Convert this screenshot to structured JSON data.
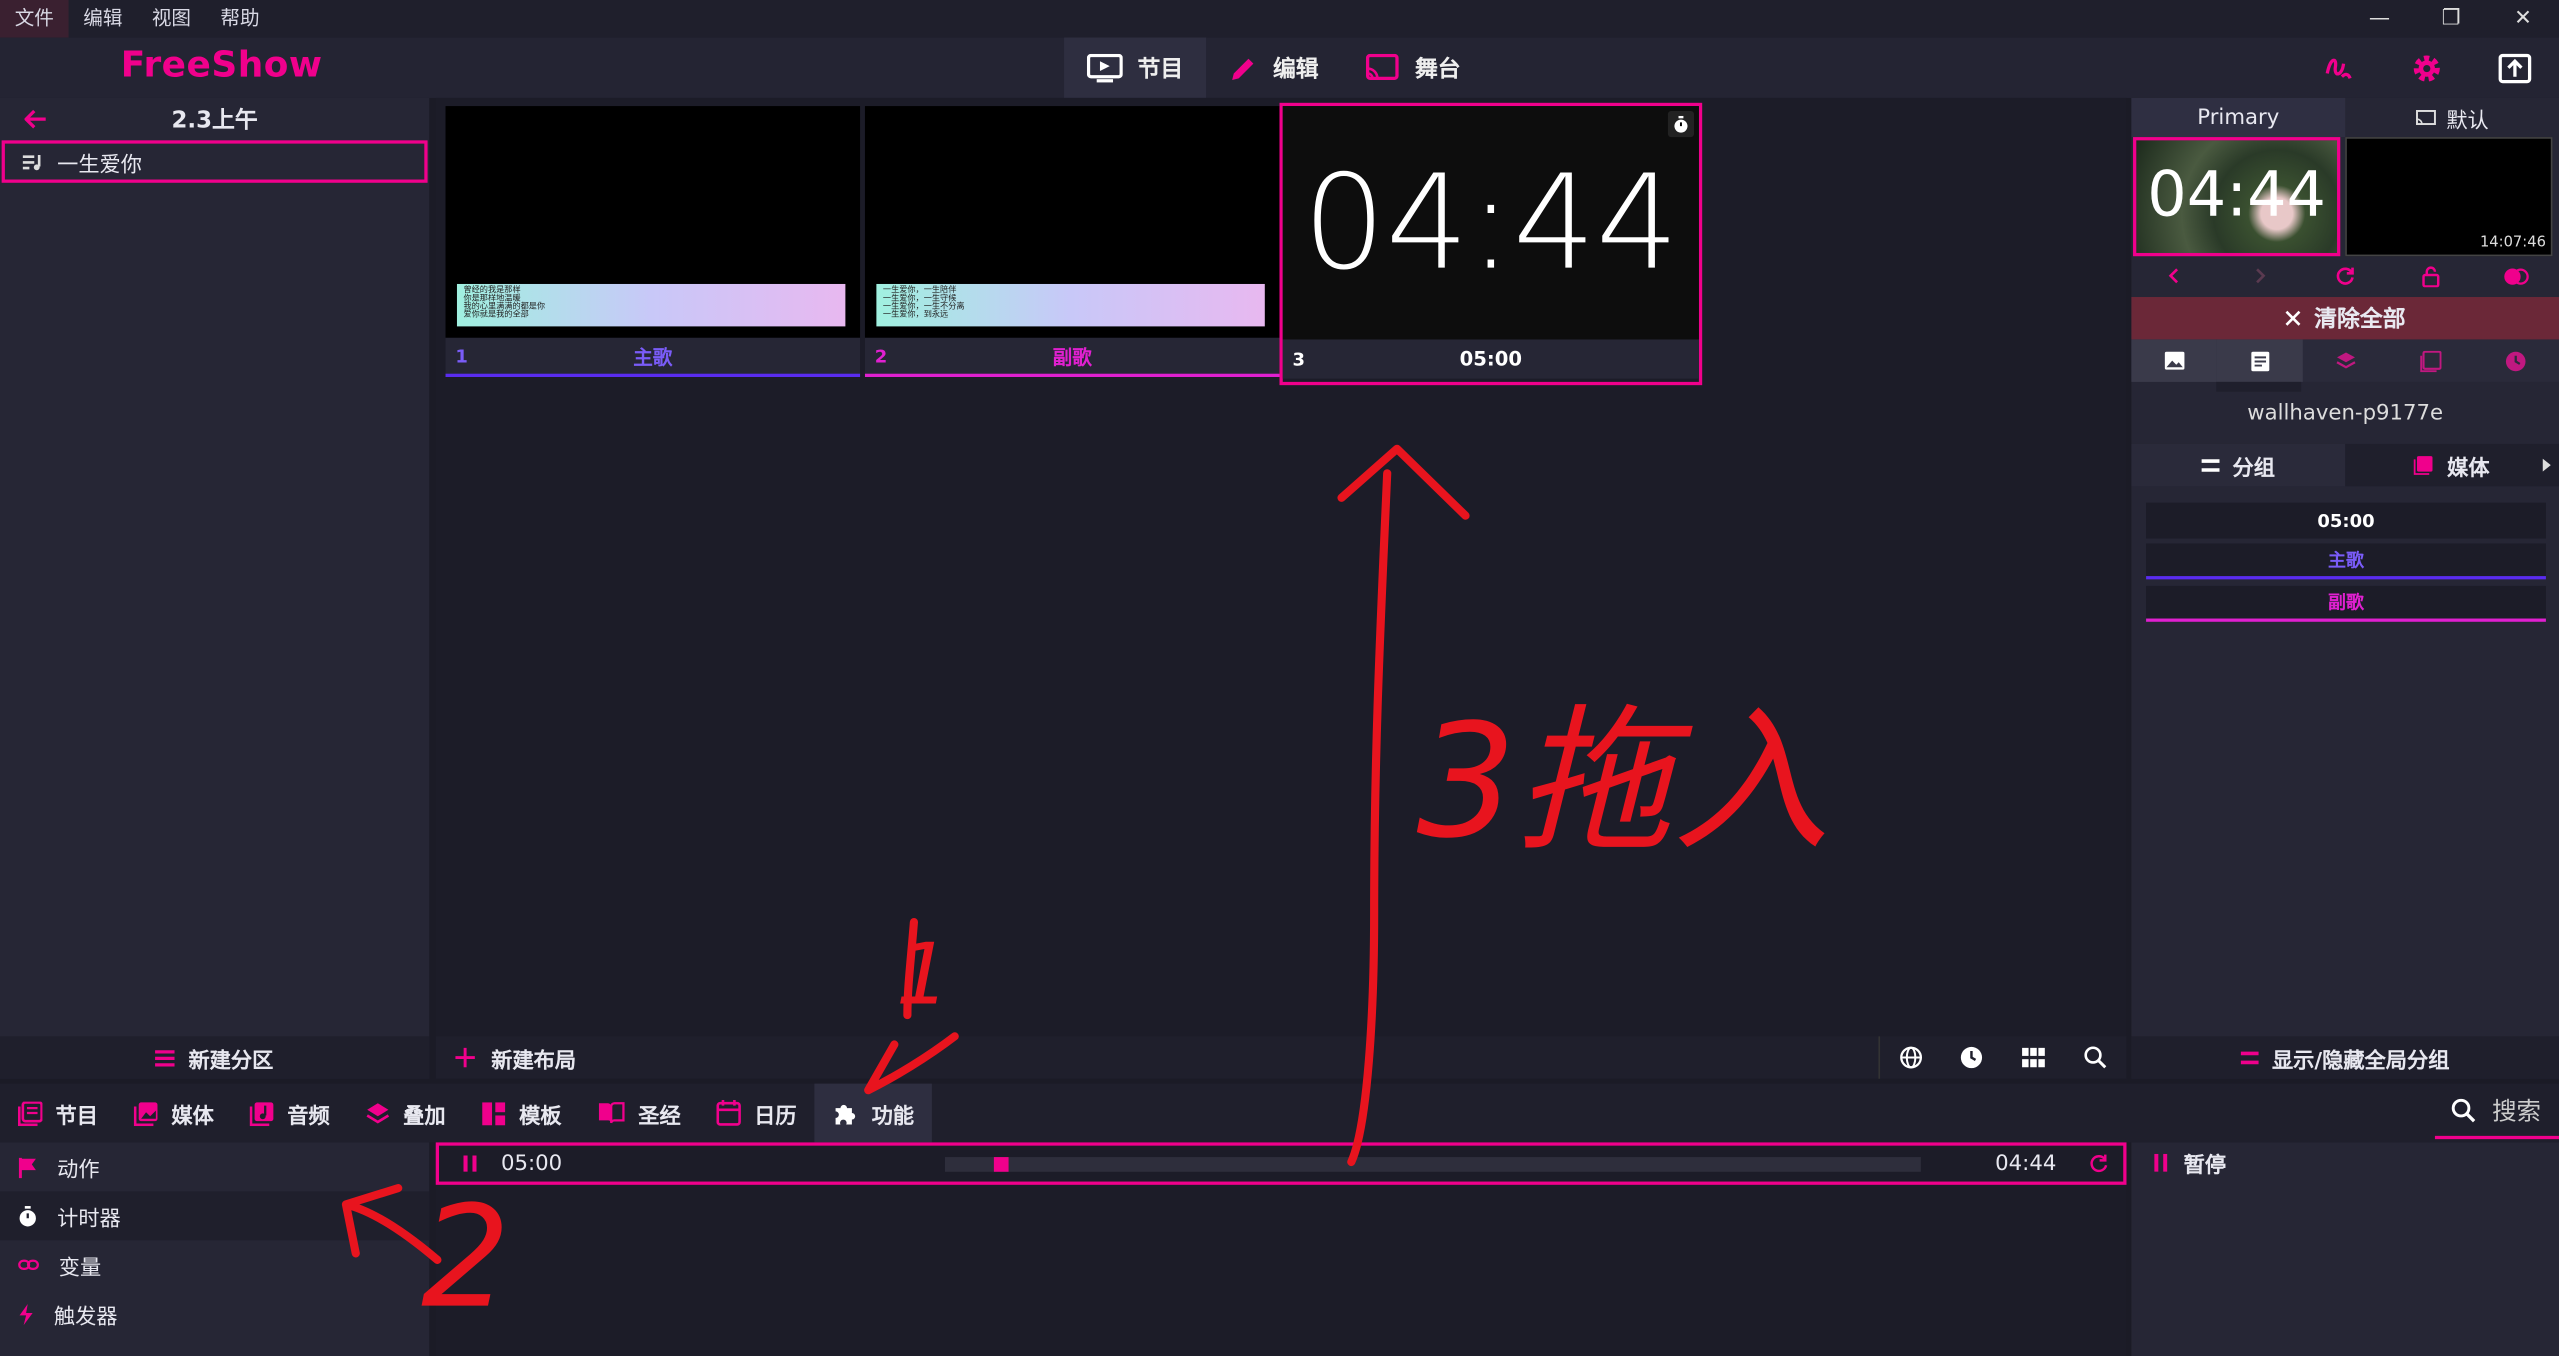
{
  "menubar": {
    "items": [
      "文件",
      "编辑",
      "视图",
      "帮助"
    ],
    "window_controls": [
      "—",
      "❐",
      "✕"
    ]
  },
  "header": {
    "logo": "FreeShow",
    "tabs": [
      {
        "label": "节目",
        "icon": "monitor-play-icon"
      },
      {
        "label": "编辑",
        "icon": "pencil-icon"
      },
      {
        "label": "舞台",
        "icon": "cast-icon"
      }
    ]
  },
  "left_panel": {
    "title": "2.3上午",
    "shows": [
      {
        "label": "一生爱你"
      }
    ],
    "footer": "新建分区"
  },
  "slides": [
    {
      "number": "1",
      "group": "主歌",
      "group_color": "#5a2cf0",
      "lyrics": [
        "曾经的我是那样",
        "你是那样地温暖",
        "我的心里满满的都是你",
        "爱你就是我的全部"
      ]
    },
    {
      "number": "2",
      "group": "副歌",
      "group_color": "#e020d0",
      "lyrics": [
        "一生爱你，一生陪伴",
        "一生爱你，一生守候",
        "一生爱你，一生不分离",
        "一生爱你，到永远"
      ]
    },
    {
      "number": "3",
      "group": "05:00",
      "timer_display": "04:44"
    }
  ],
  "center_footer": {
    "new_layout": "新建布局"
  },
  "right_panel": {
    "tabs": [
      "Primary",
      "默认"
    ],
    "preview_time": "04:44",
    "stage_clock": "14:07:46",
    "clear_all": "清除全部",
    "background_name": "wallhaven-p9177e",
    "sub_tabs": [
      "分组",
      "媒体"
    ],
    "groups": [
      {
        "label": "05:00",
        "color": "#ffffff"
      },
      {
        "label": "主歌",
        "color": "#5a2cf0"
      },
      {
        "label": "副歌",
        "color": "#e020d0"
      }
    ],
    "footer": "显示/隐藏全局分组"
  },
  "bottom_tabs": [
    "节目",
    "媒体",
    "音频",
    "叠加",
    "模板",
    "圣经",
    "日历",
    "功能"
  ],
  "search": {
    "label": "搜索"
  },
  "functions": [
    "动作",
    "计时器",
    "变量",
    "触发器"
  ],
  "timer": {
    "start": "05:00",
    "remaining": "04:44",
    "progress": 0.05
  },
  "pause": {
    "label": "暂停"
  },
  "annotations": {
    "drag_note": "3拖入",
    "step1": "1",
    "step2": "2"
  },
  "colors": {
    "accent": "#f0008c",
    "verse": "#5a2cf0",
    "chorus": "#e020d0",
    "annotation": "#e8141e"
  }
}
